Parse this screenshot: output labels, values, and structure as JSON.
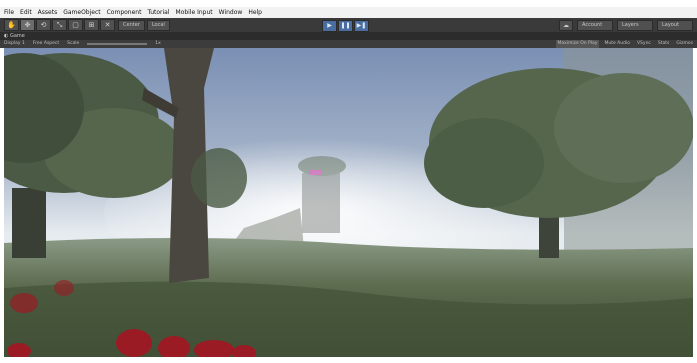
{
  "menu": [
    "File",
    "Edit",
    "Assets",
    "GameObject",
    "Component",
    "Tutorial",
    "Mobile Input",
    "Window",
    "Help"
  ],
  "toolbar": {
    "tools": [
      "hand",
      "move",
      "rotate",
      "scale",
      "rect",
      "transform",
      "custom"
    ],
    "pivot_label": "Center",
    "space_label": "Local",
    "account_label": "Account",
    "layers_label": "Layers",
    "layout_label": "Layout"
  },
  "game_tab": {
    "label": "Game"
  },
  "game_bar": {
    "display": "Display 1",
    "aspect": "Free Aspect",
    "scale_label": "Scale",
    "scale_value": "1x",
    "maximize": "Maximize On Play",
    "mute": "Mute Audio",
    "vsync": "VSync",
    "stats": "Stats",
    "gizmos": "Gizmos"
  },
  "viewport": {
    "description": "Game view rendering"
  }
}
